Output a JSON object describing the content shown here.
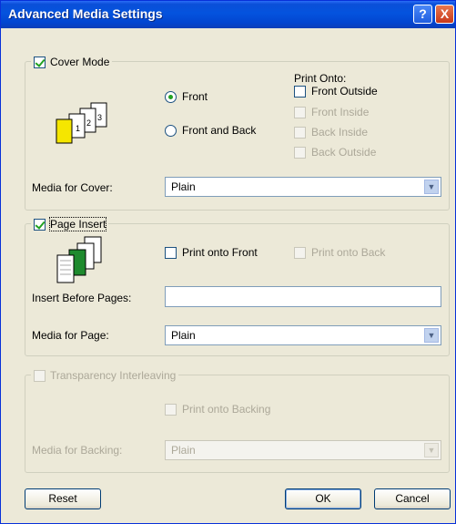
{
  "window": {
    "title": "Advanced Media Settings",
    "help_glyph": "?",
    "close_glyph": "X"
  },
  "cover_mode": {
    "label": "Cover Mode",
    "checked": true,
    "radio_front": "Front",
    "radio_front_and_back": "Front and Back",
    "print_onto_title": "Print Onto:",
    "opt_front_outside": "Front Outside",
    "opt_front_inside": "Front Inside",
    "opt_back_inside": "Back Inside",
    "opt_back_outside": "Back Outside",
    "media_label": "Media for Cover:",
    "media_value": "Plain",
    "icon_pages": [
      "1",
      "2",
      "3"
    ]
  },
  "page_insert": {
    "label": "Page Insert",
    "checked": true,
    "print_onto_front": "Print onto Front",
    "print_onto_back": "Print onto Back",
    "insert_before_label": "Insert Before Pages:",
    "insert_before_value": "",
    "media_label": "Media for Page:",
    "media_value": "Plain"
  },
  "transparency": {
    "label": "Transparency Interleaving",
    "print_onto_backing": "Print onto Backing",
    "media_label": "Media for Backing:",
    "media_value": "Plain"
  },
  "buttons": {
    "reset": "Reset",
    "ok": "OK",
    "cancel": "Cancel"
  },
  "colors": {
    "titlebar": "#0453de",
    "window_bg": "#ece9d8",
    "cover_icon": "#f5e600",
    "insert_icon": "#1e8a2e"
  }
}
